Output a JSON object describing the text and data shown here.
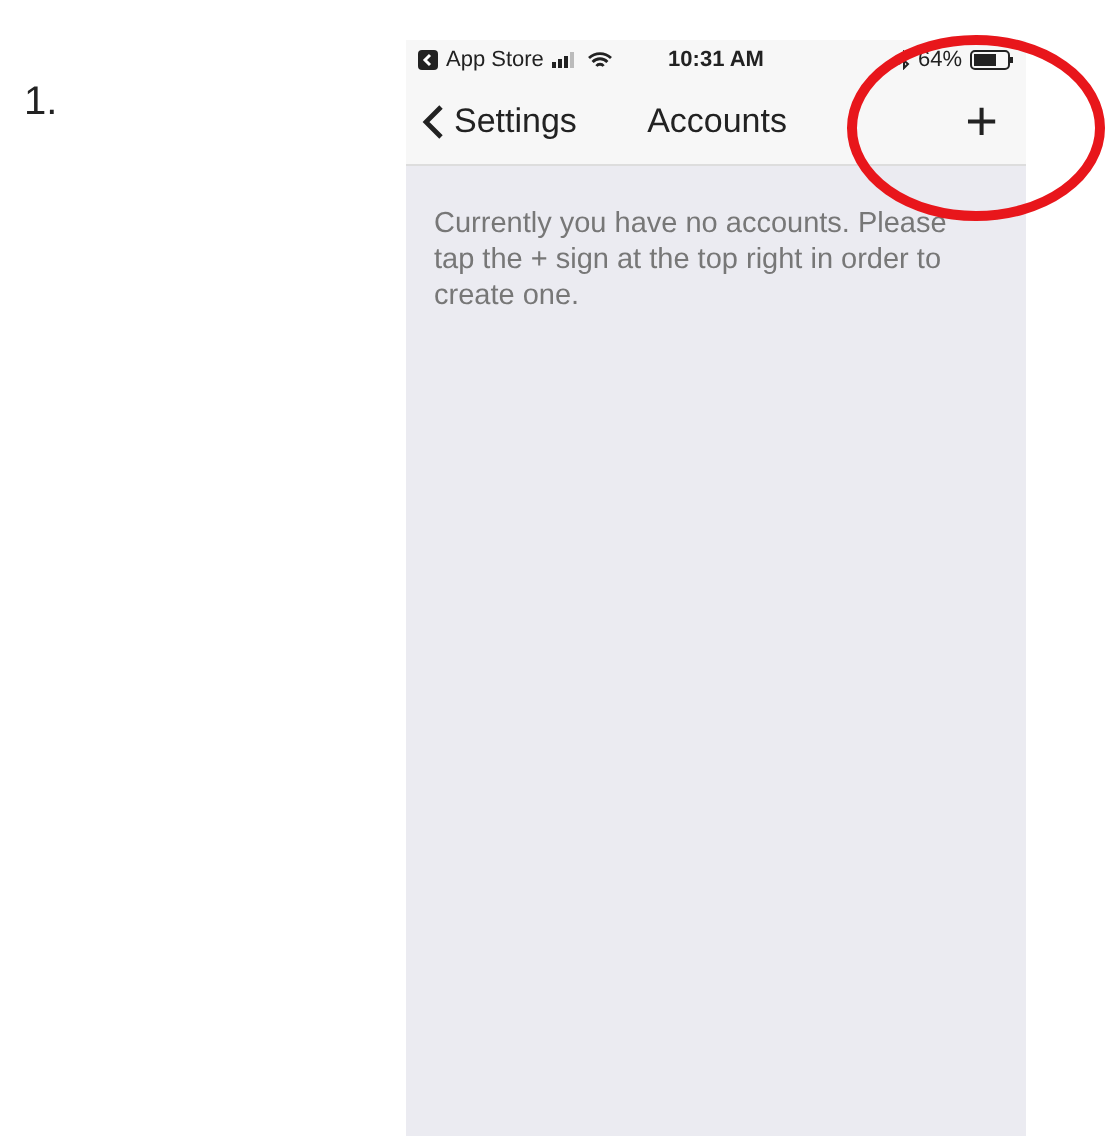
{
  "step_number": "1.",
  "status_bar": {
    "back_app": "App Store",
    "time": "10:31 AM",
    "battery": "64%"
  },
  "nav_bar": {
    "back": "Settings",
    "title": "Accounts",
    "add_button": "+"
  },
  "message": "Currently you have no accounts. Please tap the + sign at the top right in order to create one."
}
